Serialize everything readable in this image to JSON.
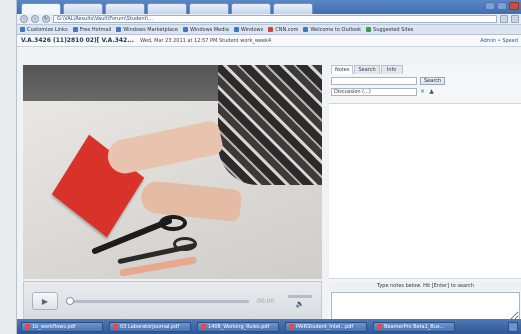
{
  "browser": {
    "tabs": [
      "",
      "",
      "",
      "",
      "",
      "",
      ""
    ],
    "url": "G:\\VAL\\Results\\Vault\\Forum\\Student\\...",
    "bookmarks": [
      {
        "label": "Customize Links",
        "icon": "blue"
      },
      {
        "label": "Free Hotmail",
        "icon": "blue"
      },
      {
        "label": "Windows Marketplace",
        "icon": "blue"
      },
      {
        "label": "Windows Media",
        "icon": "blue"
      },
      {
        "label": "Windows",
        "icon": "blue"
      },
      {
        "label": "CNN.com",
        "icon": "red"
      },
      {
        "label": "Welcome to Outlook",
        "icon": "blue"
      },
      {
        "label": "Suggested Sites",
        "icon": "green"
      }
    ]
  },
  "app": {
    "title": "V.A.3426 (11)2810 02)[ V.A.342...",
    "subtitle": "Wed, Mar 23 2011 at 12:57 PM Student work_week4",
    "right_link": "Admin • Speed"
  },
  "player": {
    "time": "00:00",
    "play_symbol": "▶",
    "volume_symbol": "🔈"
  },
  "side": {
    "tabs": [
      "Notes",
      "Search",
      "Info"
    ],
    "active_tab": 0,
    "search_button": "Search",
    "filter_value": "Discussion (...)",
    "note_prompt": "Type notes below. Hit [Enter] to search"
  },
  "taskbar": {
    "items": [
      "1b_workflows.pdf",
      "03 Laboratorjournal.pdf",
      "1408_Working_Rules.pdf",
      "PAIRStudent_Intel...pdf",
      "BeamerPro Beta1_Bus..."
    ]
  },
  "colors": {
    "accent": "#3f6fb2",
    "paper": "#d8322b"
  }
}
